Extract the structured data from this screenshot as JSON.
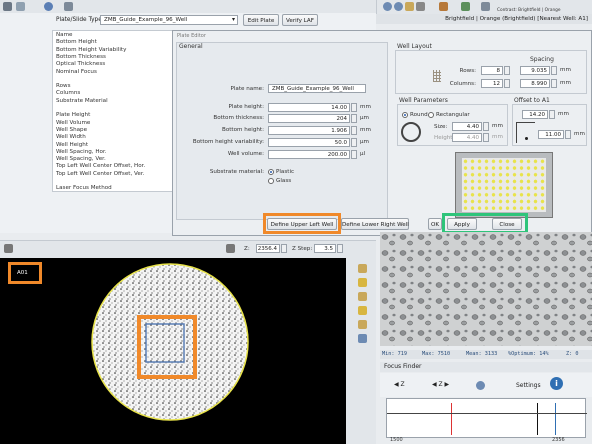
{
  "left_panel": {
    "plate_type_label": "Plate/Slide Type:",
    "plate_type_value": "ZMB_Guide_Example_96_Well",
    "edit_plate": "Edit Plate",
    "verify_laf": "Verify LAF",
    "property_list": [
      "Name",
      "Bottom Height",
      "Bottom Height Variability",
      "Bottom Thickness",
      "Optical Thickness",
      "Nominal Focus",
      "",
      "Rows",
      "Columns",
      "Substrate Material",
      "",
      "Plate Height",
      "Well Volume",
      "Well Shape",
      "Well Width",
      "Well Height",
      "Well Spacing, Hor.",
      "Well Spacing, Ver.",
      "Top Left Well Center Offset, Hor.",
      "Top Left Well Center Offset, Ver.",
      "",
      "Laser Focus Method"
    ]
  },
  "right_panel": {
    "contrast_label": "Contrast: Brightfield | Orange",
    "channel_header": "Brightfield | Orange (Brightfield) [Nearest Well: A1]"
  },
  "plate_editor": {
    "title": "Plate Editor",
    "general_title": "General",
    "plate_name_label": "Plate name:",
    "plate_name_value": "ZMB_Guide_Example_96_Well",
    "fields": [
      {
        "label": "Plate height:",
        "value": "14.00",
        "unit": "mm"
      },
      {
        "label": "Bottom thickness:",
        "value": "204",
        "unit": "µm"
      },
      {
        "label": "Bottom height:",
        "value": "1.906",
        "unit": "mm"
      },
      {
        "label": "Bottom height variability:",
        "value": "50.0",
        "unit": "µm"
      },
      {
        "label": "Well volume:",
        "value": "200.00",
        "unit": "µl"
      }
    ],
    "substrate_label": "Substrate material:",
    "substrate_options": [
      "Plastic",
      "Glass"
    ],
    "well_layout_title": "Well Layout",
    "spacing_title": "Spacing",
    "rows_label": "Rows:",
    "rows_value": "8",
    "rows_spacing": "9.035",
    "columns_label": "Columns:",
    "columns_value": "12",
    "columns_spacing": "8.990",
    "spacing_unit": "mm",
    "well_params_title": "Well Parameters",
    "shape_round": "Round",
    "shape_rect": "Rectangular",
    "size_label": "Size:",
    "size_value": "4.40",
    "height_label": "Height:",
    "height_value": "4.40",
    "offset_title": "Offset to A1",
    "offset_x": "14.20",
    "offset_y": "11.00",
    "define_ul": "Define Upper Left Well",
    "define_lr": "Define Lower Right Well",
    "ok": "OK",
    "apply": "Apply",
    "close": "Close"
  },
  "z_bar": {
    "z_label": "Z:",
    "z_value": "2356.4",
    "zstep_label": "Z Step:",
    "zstep_value": "3.5"
  },
  "viewer": {
    "well_label": "A01"
  },
  "stats": {
    "min": "Min: 719",
    "max": "Max: 7510",
    "mean": "Mean: 3133",
    "optimum": "%Optimum: 14%",
    "z": "Z: 0"
  },
  "focus_finder": {
    "title": "Focus Finder",
    "settings": "Settings",
    "axis_left": "1500",
    "axis_right": "2356"
  },
  "colors": {
    "highlight_orange": "#f0892a",
    "highlight_green": "#2ec47a",
    "well_yellow": "#e8e34a"
  }
}
